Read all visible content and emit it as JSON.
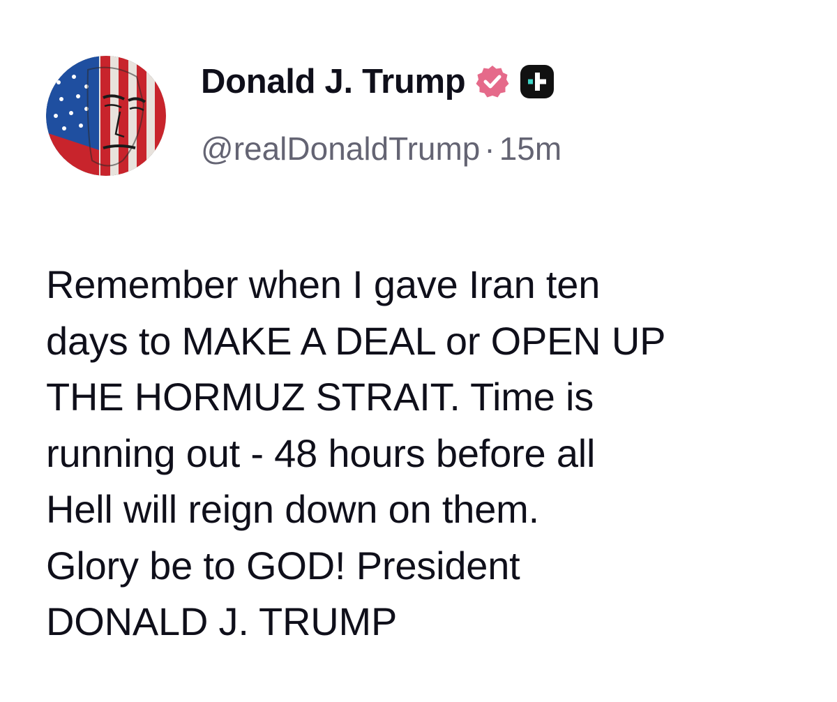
{
  "author": {
    "display_name": "Donald J. Trump",
    "handle": "@realDonaldTrump",
    "separator": "·",
    "timestamp": "15m"
  },
  "colors": {
    "verified_badge": "#e56a8a",
    "platform_badge": "#111111",
    "text": "#0f0f1a",
    "handle": "#646473"
  },
  "icons": {
    "verified": "verified-badge-icon",
    "platform": "plus-badge-icon"
  },
  "post": {
    "lines": [
      "Remember when I gave Iran ten",
      "days to MAKE A DEAL or OPEN UP",
      "THE HORMUZ STRAIT. Time is",
      "running out - 48 hours before all",
      "Hell will reign down on them.",
      "Glory be to GOD! President",
      "DONALD J. TRUMP"
    ]
  }
}
